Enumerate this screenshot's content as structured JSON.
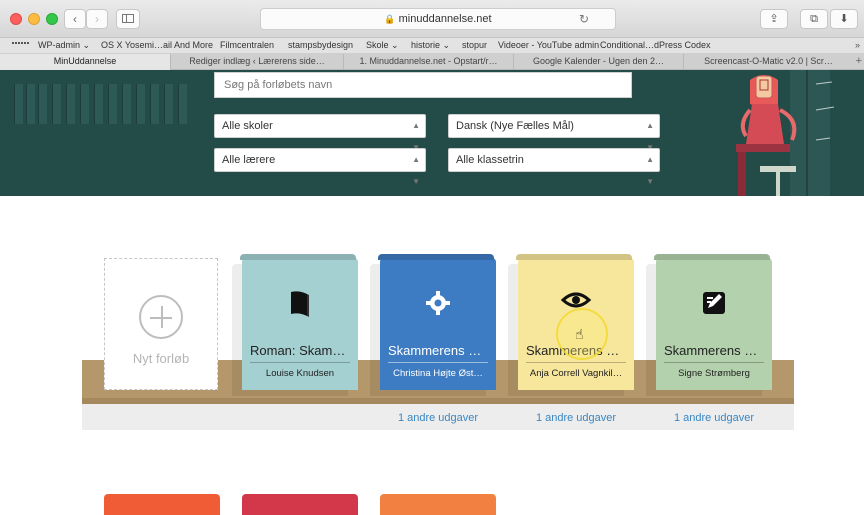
{
  "browser": {
    "url": "minuddannelse.net",
    "bookmarks": [
      "WP-admin ⌄",
      "OS X Yosemi…ail And More",
      "Filmcentralen",
      "stampsbydesign",
      "Skole ⌄",
      "historie ⌄",
      "stopur",
      "Videoer - YouTube admin",
      "Conditional…dPress Codex"
    ],
    "bookmarks_more": "»",
    "tabs": [
      "MinUddannelse",
      "Rediger indlæg ‹ Lærerens side…",
      "1. Minuddannelse.net - Opstart/r…",
      "Google Kalender - Ugen den 2…",
      "Screencast-O-Matic v2.0 | Scr…"
    ],
    "tab_new": "+"
  },
  "filters": {
    "search_placeholder": "Søg på forløbets navn",
    "school": "Alle skoler",
    "teacher": "Alle lærere",
    "subject": "Dansk (Nye Fælles Mål)",
    "grade": "Alle klassetrin"
  },
  "new_course": {
    "label": "Nyt forløb"
  },
  "books": [
    {
      "title": "Roman: Skam…",
      "author": "Louise Knudsen",
      "icon": "book-icon",
      "color": "#a5d0d2",
      "other_editions": ""
    },
    {
      "title": "Skammerens D…",
      "author": "Christina Højte Øst…",
      "icon": "gear-icon",
      "color": "#3d7cc2",
      "other_editions": "1 andre udgaver"
    },
    {
      "title": "Skammerens d…",
      "author": "Anja Correll Vagnkil…",
      "icon": "eye-icon",
      "color": "#f7e79c",
      "other_editions": "1 andre udgaver"
    },
    {
      "title": "Skammerens d…",
      "author": "Signe Strømberg",
      "icon": "edit-note-icon",
      "color": "#b3d1ac",
      "other_editions": "1 andre udgaver"
    }
  ],
  "colors": {
    "header": "#234b48",
    "shelf": "#b4976a",
    "link": "#3a87c4"
  }
}
